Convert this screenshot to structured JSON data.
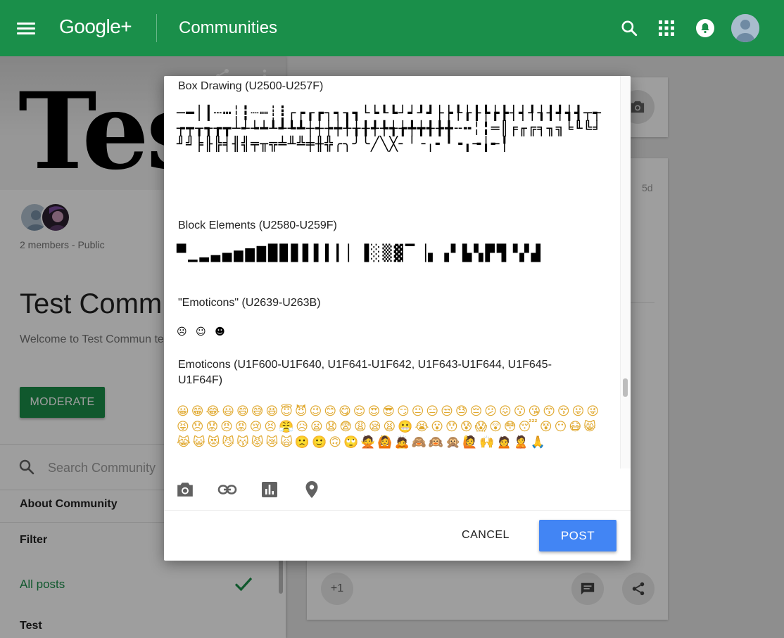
{
  "topbar": {
    "brand": "Google+",
    "title": "Communities",
    "icons": [
      "menu-icon",
      "search-icon",
      "apps-grid-icon",
      "notifications-bell-icon",
      "account-avatar"
    ]
  },
  "community": {
    "cover_text": "Tes",
    "members_text": "2 members - Public",
    "title": "Test Comm",
    "description": "Welcome to Test Commun test the Google Plus featu",
    "moderate_label": "MODERATE"
  },
  "sidebar": {
    "search_placeholder": "Search Community",
    "about_label": "About Community",
    "filter_label": "Filter",
    "all_posts_label": "All posts",
    "category_label": "Test"
  },
  "background_post": {
    "time": "5d",
    "plus_one": "+1"
  },
  "dialog": {
    "sections": [
      {
        "heading": "Box Drawing (U2500-U257F)",
        "glyphs": "─━│┃┄┅┆┇┈┉┊┋┌┍┎┏┐┑┒┓└┕┖┗┘┙┚┛├┝┞┟┠┡┢┣┤┥┦┧┨┩┪┫┬┭┮┯┰┱┲┳┴┵┶┷┸┹┺┻┼┽┾┿╀╁╂╃╄╅╆╇╈╉╊╋╌╍╎╏═║╒╓╔╕╖╗╘╙╚╛╜╝╞╟╠╡╢╣╤╥╦╧╨╩╪╫╬╭╮╯╰╱╲╳╴╵╶╷╸╹╺╻╼╽╾╿"
      },
      {
        "heading": "Block Elements (U2580-U259F)",
        "glyphs": "▀▁▂▃▄▅▆▇█▉▊▋▌▍▎▏▐░▒▓▔▕▖▗▘▙▚▛▜▝▞▟"
      },
      {
        "heading": "\"Emoticons\" (U2639-U263B)",
        "glyphs": "☹ ☺ ☻"
      },
      {
        "heading": "Emoticons (U1F600-U1F640, U1F641-U1F642, U1F643-U1F644, U1F645-U1F64F)",
        "glyphs": "😀😁😂😃😄😅😆😇😈😉😊😋😌😍😎😏😐😑😒😓😔😕😖😗😘😙😚😛😜😝😞😟😠😡😢😣😤😥😦😧😨😩😪😫😬😭😮😯😰😱😲😳😴😵😶😷😸😹😺😻😼😽😾😿🙀🙁🙂🙃🙄🙅🙆🙇🙈🙉🙊🙋🙌🙍🙎🙏"
      }
    ],
    "tools": [
      "camera-icon",
      "link-icon",
      "poll-chart-icon",
      "location-pin-icon"
    ],
    "cancel_label": "CANCEL",
    "post_label": "POST"
  },
  "colors": {
    "brand_green": "#1a8f4a",
    "post_blue": "#4285f4"
  }
}
